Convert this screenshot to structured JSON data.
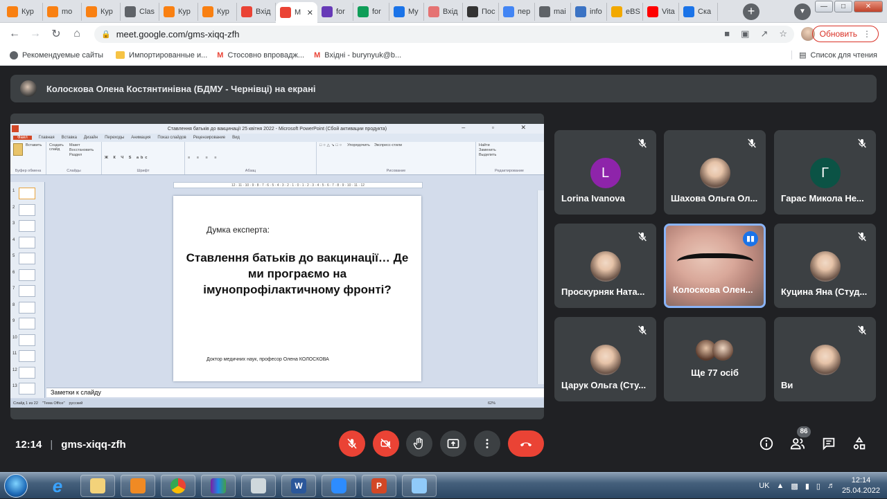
{
  "browser": {
    "tabs": [
      {
        "label": "Кур",
        "icon": "moodle-icon",
        "color": "#f98012"
      },
      {
        "label": "mo",
        "icon": "moodle-icon",
        "color": "#f98012"
      },
      {
        "label": "Кур",
        "icon": "moodle-icon",
        "color": "#f98012"
      },
      {
        "label": "Clas",
        "icon": "globe-icon",
        "color": "#5f6368"
      },
      {
        "label": "Кур",
        "icon": "moodle-icon",
        "color": "#f98012"
      },
      {
        "label": "Кур",
        "icon": "moodle-icon",
        "color": "#f98012"
      },
      {
        "label": "Вхід",
        "icon": "gmail-icon",
        "color": "#ea4335"
      },
      {
        "label": "M",
        "icon": "record-icon",
        "color": "#ea4335"
      },
      {
        "label": "for",
        "icon": "forms-icon",
        "color": "#673ab7"
      },
      {
        "label": "for",
        "icon": "sheets-icon",
        "color": "#0f9d58"
      },
      {
        "label": "My",
        "icon": "circle-icon",
        "color": "#1a73e8"
      },
      {
        "label": "Вхід",
        "icon": "cloud-icon",
        "color": "#e57373"
      },
      {
        "label": "Пос",
        "icon": "avatar-icon",
        "color": "#333333"
      },
      {
        "label": "пер",
        "icon": "google-icon",
        "color": "#4285f4"
      },
      {
        "label": "mai",
        "icon": "globe-icon",
        "color": "#5f6368"
      },
      {
        "label": "info",
        "icon": "flask-icon",
        "color": "#3b73c4"
      },
      {
        "label": "eBS",
        "icon": "ebs-icon",
        "color": "#f2a900"
      },
      {
        "label": "Vita",
        "icon": "youtube-icon",
        "color": "#ff0000"
      },
      {
        "label": "Ска",
        "icon": "download-icon",
        "color": "#1a73e8"
      }
    ],
    "url": "meet.google.com/gms-xiqq-zfh",
    "update_button": "Обновить",
    "bookmarks": [
      {
        "label": "Рекомендуемые сайты",
        "icon": "globe-icon"
      },
      {
        "label": "Импортированные и...",
        "icon": "folder-icon"
      },
      {
        "label": "Стосовно впровадж...",
        "icon": "gmail-icon"
      },
      {
        "label": "Вхідні - burynyuk@b...",
        "icon": "gmail-icon"
      }
    ],
    "reading_list": "Список для чтения"
  },
  "meet": {
    "presenter_banner": "Колоскова Олена Костянтинівна (БДМУ - Чернівці) на екрані",
    "time": "12:14",
    "meeting_code": "gms-xiqq-zfh",
    "participant_count": "86",
    "participants": [
      {
        "name": "Lorina Ivanova",
        "initial": "L",
        "avatar_color": "#8e24aa",
        "muted": true
      },
      {
        "name": "Шахова Ольга Ол...",
        "initial": "",
        "avatar_color": "",
        "muted": true
      },
      {
        "name": "Гарас Микола Не...",
        "initial": "Г",
        "avatar_color": "#0b5345",
        "muted": true
      },
      {
        "name": "Проскурняк Ната...",
        "initial": "",
        "avatar_color": "",
        "muted": true
      },
      {
        "name": "Колоскова Олен...",
        "initial": "",
        "avatar_color": "",
        "muted": false
      },
      {
        "name": "Куцина Яна (Студ...",
        "initial": "",
        "avatar_color": "",
        "muted": true
      },
      {
        "name": "Царук Ольга (Сту...",
        "initial": "",
        "avatar_color": "",
        "muted": true
      },
      {
        "name": "Ще 77 осіб",
        "initial": "",
        "avatar_color": "",
        "muted": false
      },
      {
        "name": "Ви",
        "initial": "",
        "avatar_color": "",
        "muted": true
      }
    ]
  },
  "powerpoint": {
    "window_title": "Ставлення батьків до вакцинації 25 квітня 2022 - Microsoft PowerPoint (Сбой активации продукта)",
    "ribbon_tabs": [
      "Файл",
      "Главная",
      "Вставка",
      "Дизайн",
      "Переходы",
      "Анимация",
      "Показ слайдов",
      "Рецензирование",
      "Вид"
    ],
    "ribbon_groups": [
      "Буфер обмена",
      "Слайды",
      "Шрифт",
      "Абзац",
      "Рисование",
      "Редактирование"
    ],
    "ribbon_items": {
      "paste": "Вставить",
      "new_slide": "Создать слайд",
      "layout": "Макет",
      "reset": "Восстановить",
      "section": "Раздел",
      "arrange": "Упорядочить",
      "quick_styles": "Экспресс-стили",
      "find": "Найти",
      "replace": "Заменить",
      "select": "Выделить"
    },
    "ruler": "12 · 11 · 10 · 9 · 8 · 7 · 6 · 5 · 4 · 3 · 2 · 1 · 0 · 1 · 2 · 3 · 4 · 5 · 6 · 7 · 8 · 9 · 10 · 11 · 12",
    "thumb_numbers": [
      "1",
      "2",
      "3",
      "4",
      "5",
      "6",
      "7",
      "8",
      "9",
      "10",
      "11",
      "12",
      "13"
    ],
    "slide": {
      "label": "Думка експерта:",
      "title": "Ставлення батьків до вакцинації… Де ми програємо на імунопрофілактичному фронті?",
      "author": "Доктор медичних наук, професор Олена КОЛОСКОВА"
    },
    "notes": "Заметки к слайду",
    "status": {
      "slide_of": "Слайд 1 из 22",
      "theme": "\"Тема Office\"",
      "language": "русский",
      "zoom": "62%"
    }
  },
  "taskbar": {
    "language": "UK",
    "time": "12:14",
    "date": "25.04.2022"
  }
}
